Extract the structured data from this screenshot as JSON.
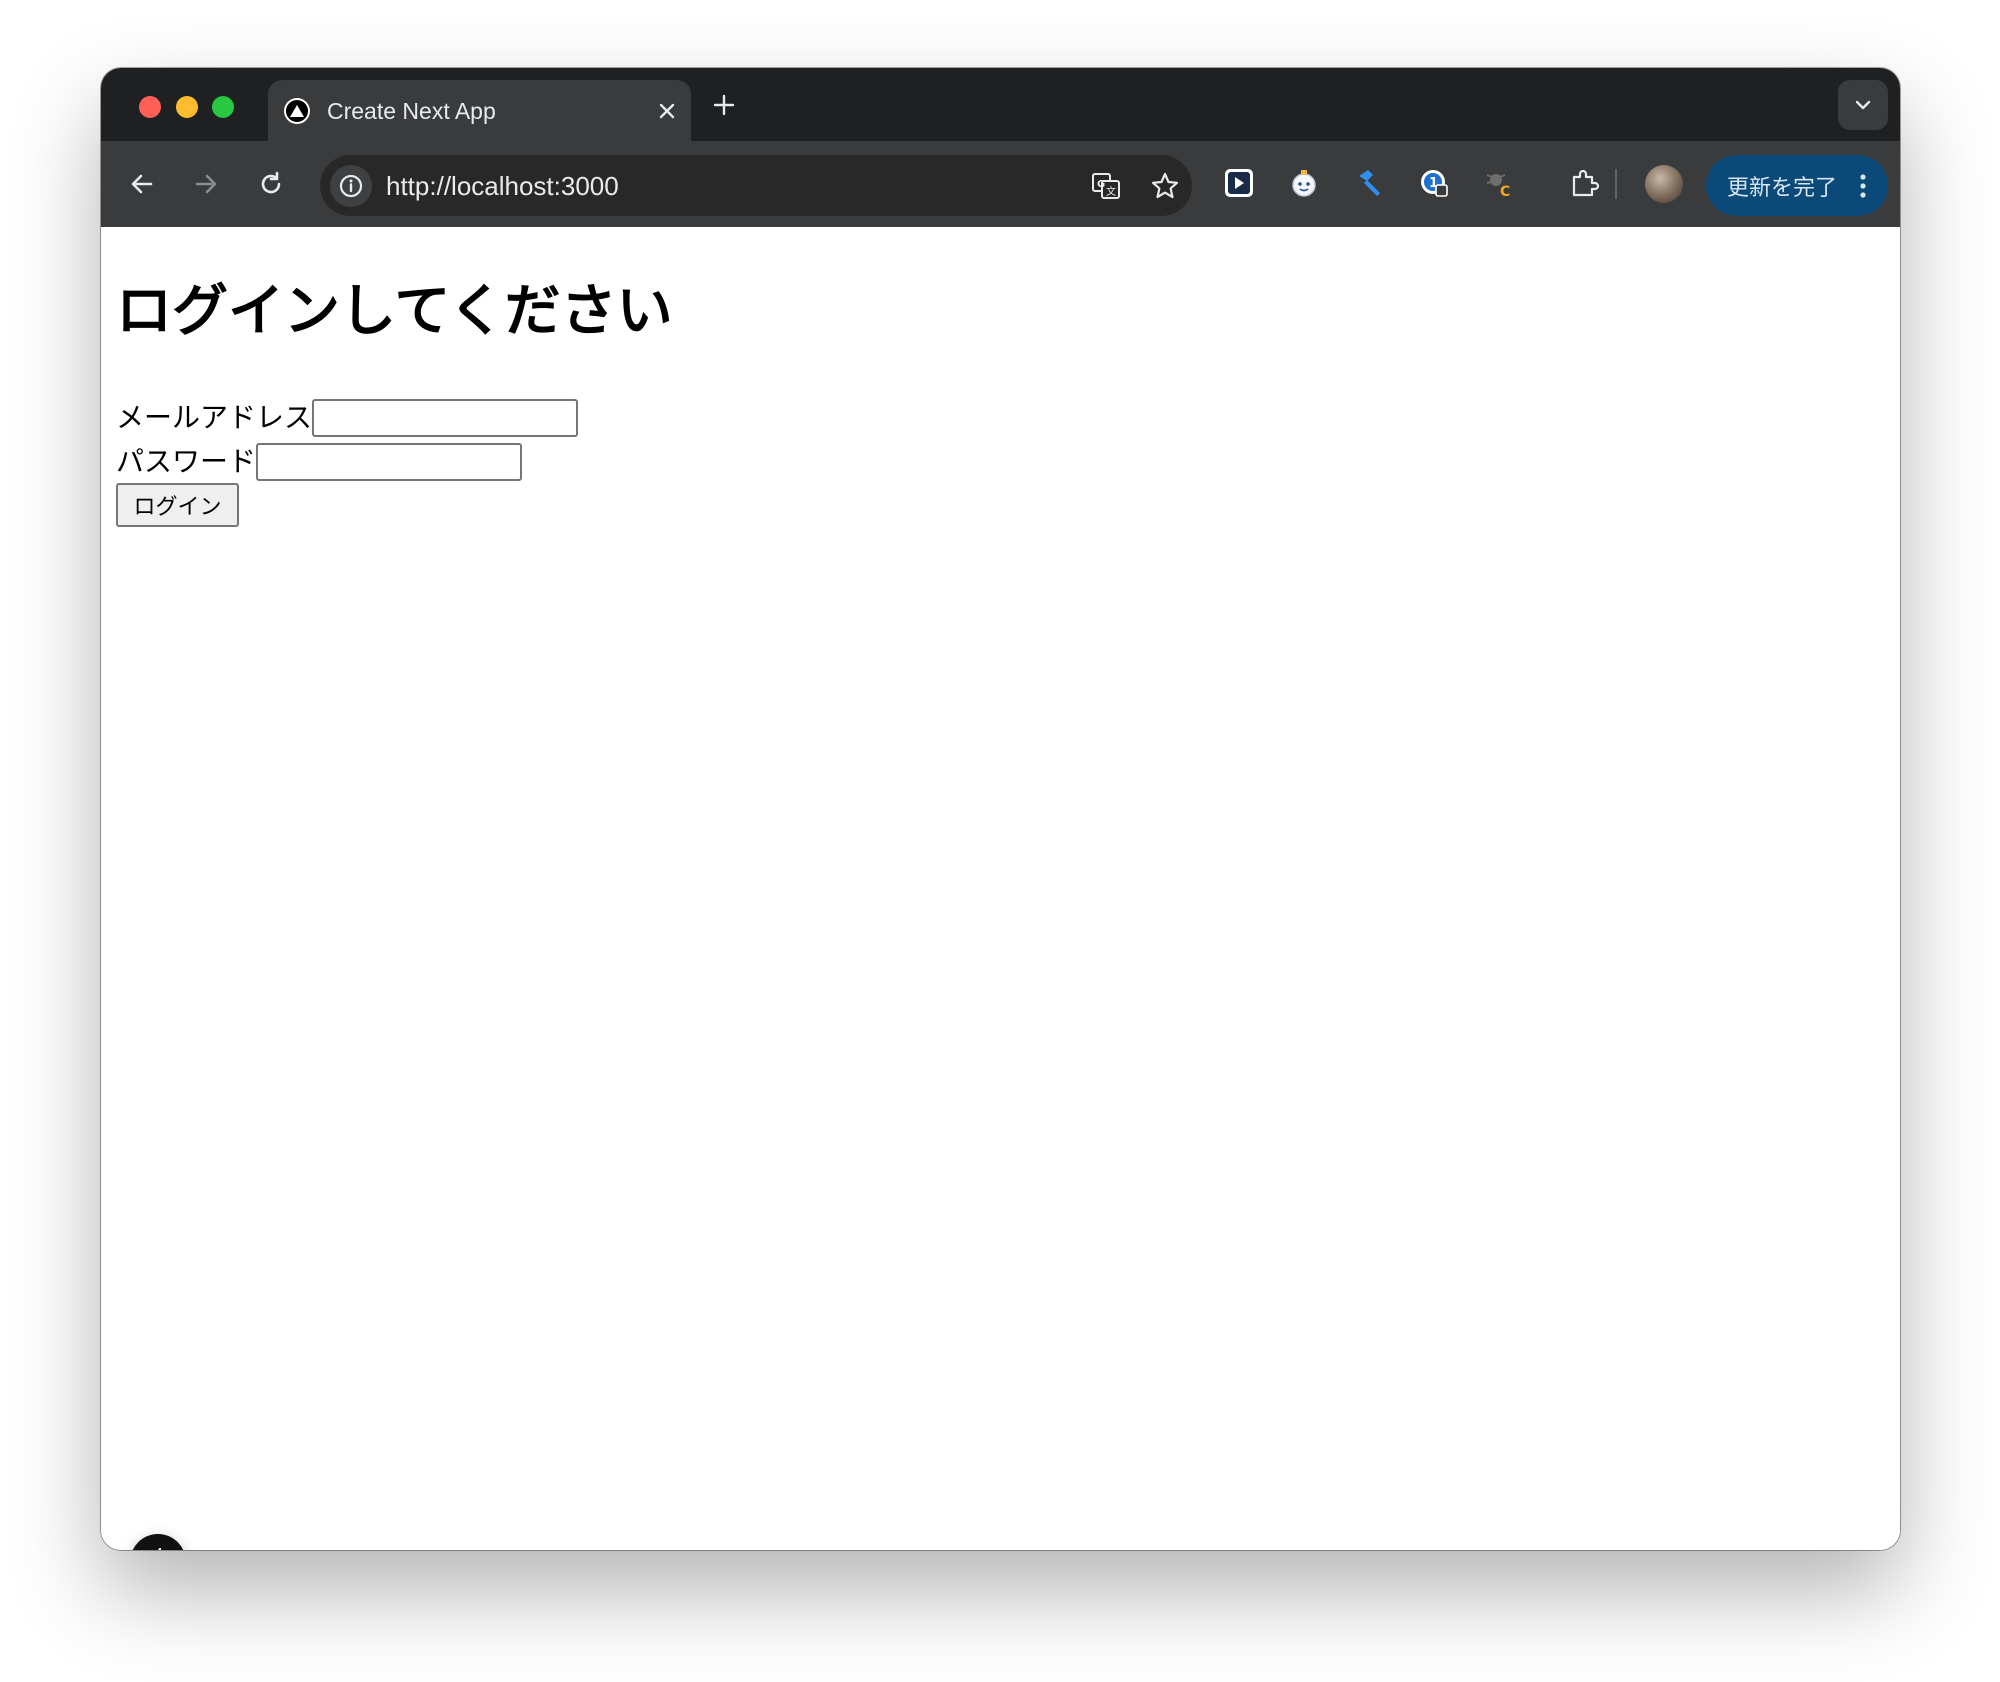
{
  "browser": {
    "tab": {
      "title": "Create Next App",
      "favicon": "nextjs-triangle-icon"
    },
    "address_bar": {
      "url": "http://localhost:3000"
    },
    "update_button": {
      "label": "更新を完了"
    },
    "icons": {
      "back": "arrow-left-icon",
      "forward": "arrow-right-icon",
      "reload": "reload-icon",
      "site_info": "info-icon",
      "translate": "translate-icon",
      "bookmark": "star-icon",
      "extensions": "puzzle-icon",
      "menu": "more-vertical-icon"
    }
  },
  "page": {
    "heading": "ログインしてください",
    "form": {
      "email_label": "メールアドレス",
      "email_value": "",
      "password_label": "パスワード",
      "password_value": "",
      "submit_label": "ログイン"
    }
  },
  "colors": {
    "tabstrip": "#1f2021",
    "toolbar": "#3a3b3d",
    "omnibox": "#282828",
    "update_button": "#0b4a78"
  }
}
